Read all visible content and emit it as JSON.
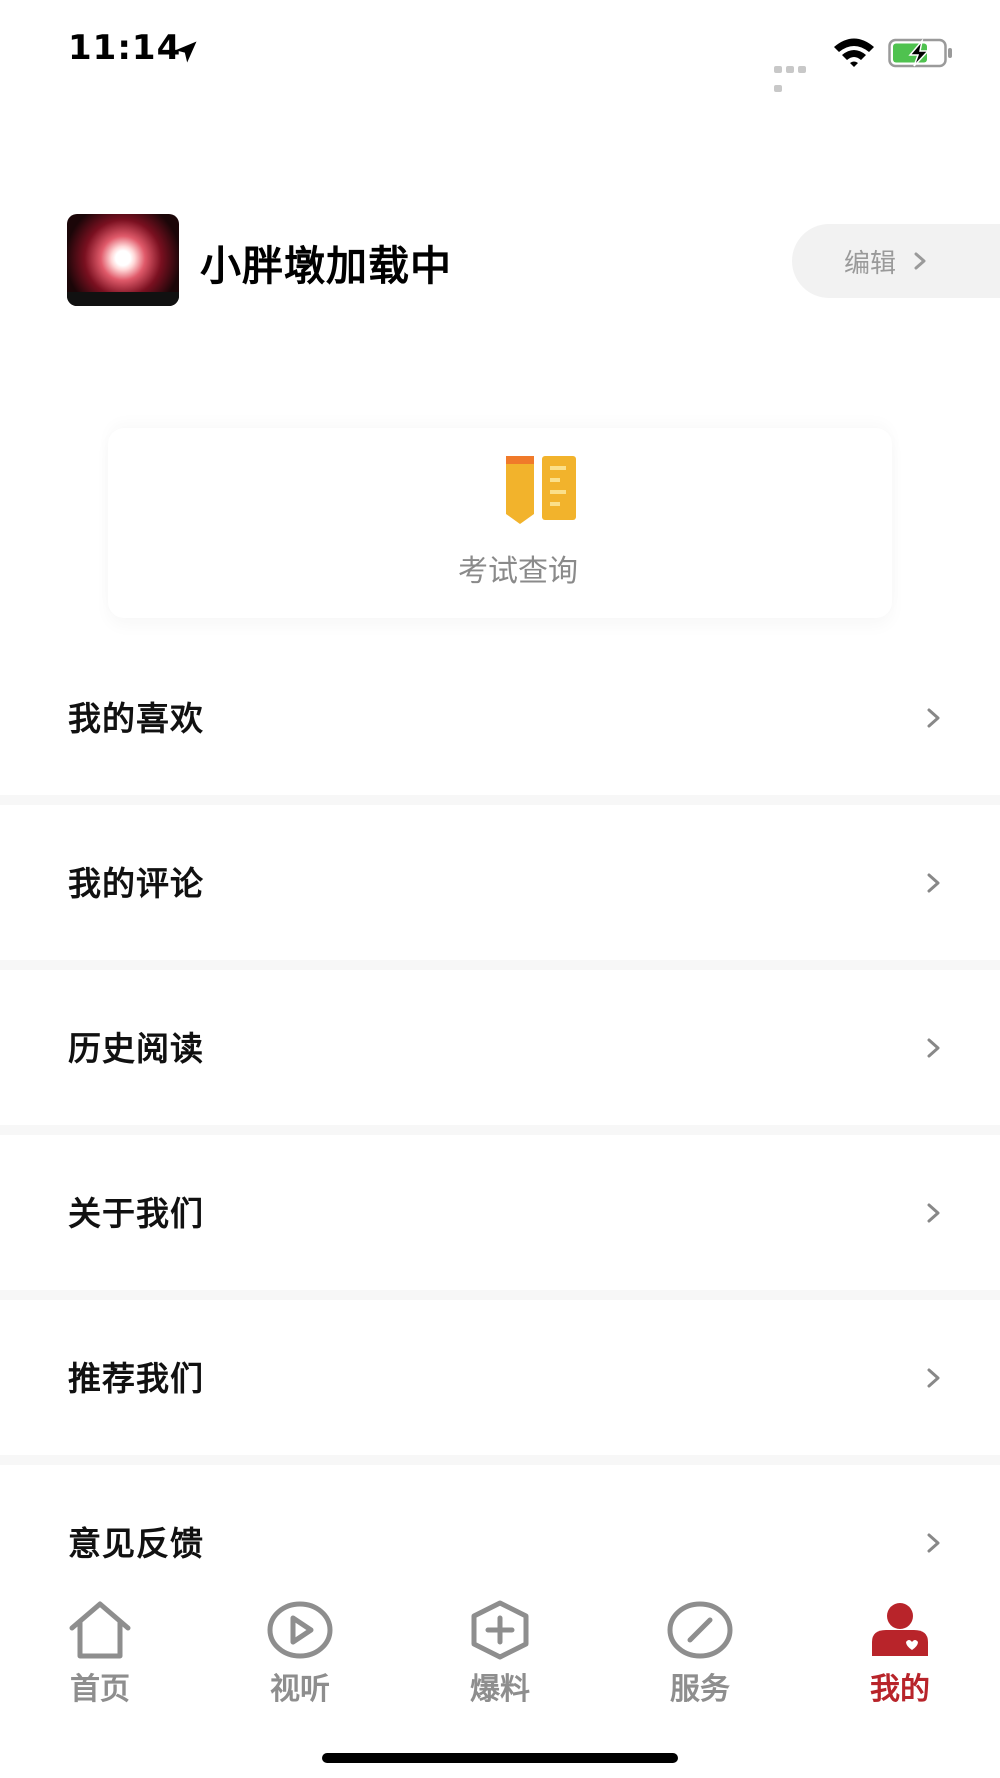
{
  "status_bar": {
    "time": "11:14",
    "icons": [
      "location-arrow-icon",
      "cellular-signal-icon",
      "wifi-icon",
      "battery-charging-icon"
    ]
  },
  "profile": {
    "username": "小胖墩加载中",
    "edit_label": "编辑"
  },
  "exam": {
    "label": "考试查询",
    "icon": "exam-ruler-icon",
    "colors": {
      "primary": "#f2b32c",
      "accent": "#f07a2a"
    }
  },
  "menu": {
    "items": [
      {
        "label": "我的喜欢"
      },
      {
        "label": "我的评论"
      },
      {
        "label": "历史阅读"
      },
      {
        "label": "关于我们"
      },
      {
        "label": "推荐我们"
      },
      {
        "label": "意见反馈"
      }
    ]
  },
  "tab_bar": {
    "active_index": 4,
    "active_color": "#b8242a",
    "inactive_color": "#8e8e8e",
    "tabs": [
      {
        "label": "首页",
        "icon": "home-icon"
      },
      {
        "label": "视听",
        "icon": "play-icon"
      },
      {
        "label": "爆料",
        "icon": "add-hexagon-icon"
      },
      {
        "label": "服务",
        "icon": "compass-icon"
      },
      {
        "label": "我的",
        "icon": "user-icon"
      }
    ]
  }
}
